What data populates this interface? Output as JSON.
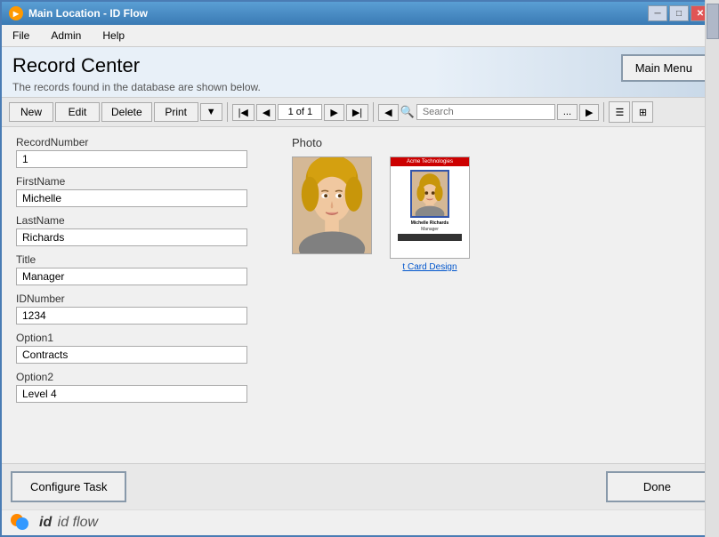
{
  "window": {
    "title": "Main Location - ID Flow"
  },
  "menu": {
    "items": [
      "File",
      "Admin",
      "Help"
    ]
  },
  "header": {
    "title": "Record Center",
    "subtitle": "The records found in the database are shown below.",
    "main_menu_label": "Main Menu"
  },
  "toolbar": {
    "new_label": "New",
    "edit_label": "Edit",
    "delete_label": "Delete",
    "print_label": "Print",
    "page_info": "1 of 1",
    "search_placeholder": "Search"
  },
  "fields": [
    {
      "label": "RecordNumber",
      "value": "1"
    },
    {
      "label": "FirstName",
      "value": "Michelle"
    },
    {
      "label": "LastName",
      "value": "Richards"
    },
    {
      "label": "Title",
      "value": "Manager"
    },
    {
      "label": "IDNumber",
      "value": "1234"
    },
    {
      "label": "Option1",
      "value": "Contracts"
    },
    {
      "label": "Option2",
      "value": "Level 4"
    }
  ],
  "photo_section": {
    "label": "Photo"
  },
  "id_card": {
    "company": "Acme Technologies",
    "name": "Michelle Richards",
    "title": "Manager",
    "link_text": "t Card Design"
  },
  "footer": {
    "configure_task_label": "Configure Task",
    "done_label": "Done"
  },
  "branding": {
    "text": "id flow"
  }
}
